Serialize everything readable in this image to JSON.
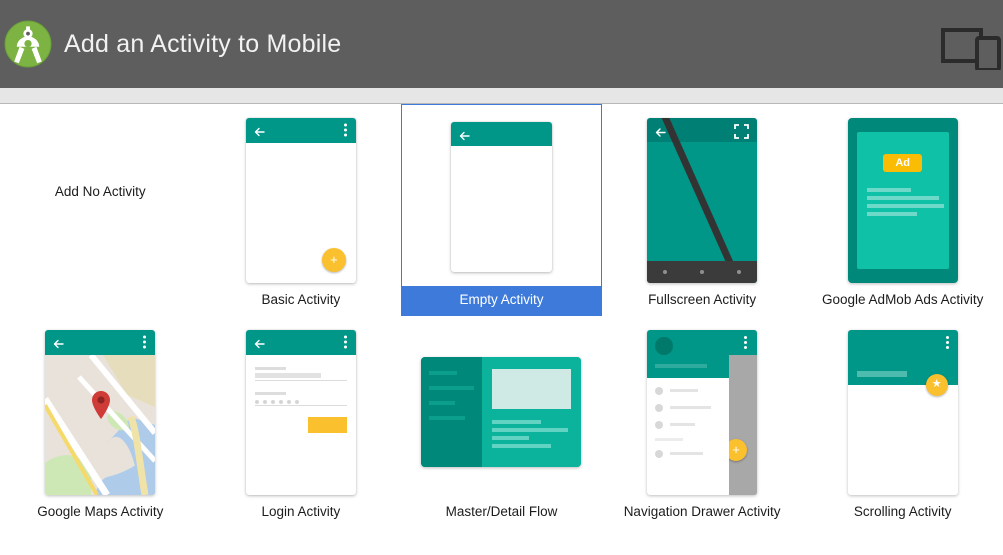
{
  "header": {
    "title": "Add an Activity to Mobile",
    "logo_icon": "android-studio-logo",
    "device_icon": "device-preview-icon",
    "background_color": "#5e5e5e",
    "title_color": "#f2f2f2"
  },
  "theme": {
    "accent_teal": "#009688",
    "accent_amber": "#fbc02d",
    "selection_blue": "#3d7ada",
    "page_background": "#ffffff"
  },
  "gallery": {
    "items": [
      {
        "label": "Add No Activity",
        "thumb": "none",
        "selected": false
      },
      {
        "label": "Basic Activity",
        "thumb": "basic",
        "selected": false,
        "fab_icon": "plus-icon"
      },
      {
        "label": "Empty Activity",
        "thumb": "empty",
        "selected": true
      },
      {
        "label": "Fullscreen Activity",
        "thumb": "fullscreen",
        "selected": false,
        "expand_icon": "fullscreen-expand-icon"
      },
      {
        "label": "Google AdMob Ads Activity",
        "thumb": "admob",
        "selected": false,
        "ad_badge": "Ad"
      },
      {
        "label": "Google Maps Activity",
        "thumb": "maps",
        "selected": false,
        "pin_icon": "map-pin-icon"
      },
      {
        "label": "Login Activity",
        "thumb": "login",
        "selected": false
      },
      {
        "label": "Master/Detail Flow",
        "thumb": "masterdetail",
        "selected": false
      },
      {
        "label": "Navigation Drawer Activity",
        "thumb": "navdrawer",
        "selected": false,
        "fab_icon": "plus-icon"
      },
      {
        "label": "Scrolling Activity",
        "thumb": "scrolling",
        "selected": false,
        "fab_icon": "star-icon"
      }
    ]
  }
}
